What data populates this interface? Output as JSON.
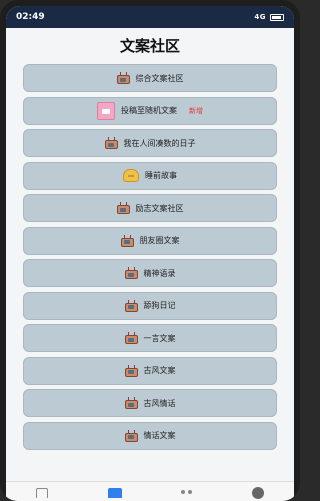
{
  "statusbar": {
    "time": "02:49",
    "signal": "4G",
    "battery_icon": "battery-icon"
  },
  "page": {
    "title": "文案社区"
  },
  "items": [
    {
      "label": "综合文案社区",
      "icon": "tv-icon"
    },
    {
      "label": "投稿至随机文案",
      "icon": "pink-card-icon",
      "badge": "新增"
    },
    {
      "label": "我在人间凑数的日子",
      "icon": "tv-icon"
    },
    {
      "label": "睡前故事",
      "icon": "bread-icon"
    },
    {
      "label": "励志文案社区",
      "icon": "tv-icon"
    },
    {
      "label": "朋友圈文案",
      "icon": "tv-icon"
    },
    {
      "label": "精神语录",
      "icon": "tv-icon"
    },
    {
      "label": "舔狗日记",
      "icon": "tv-icon"
    },
    {
      "label": "一言文案",
      "icon": "tv-icon"
    },
    {
      "label": "古风文案",
      "icon": "tv-icon"
    },
    {
      "label": "古风情话",
      "icon": "tv-icon"
    },
    {
      "label": "情话文案",
      "icon": "tv-icon"
    }
  ],
  "bottom_nav": [
    {
      "name": "nav-home",
      "icon": "doc-icon",
      "active": false
    },
    {
      "name": "nav-community",
      "icon": "clipboard-icon",
      "active": true
    },
    {
      "name": "nav-discover",
      "icon": "dots-icon",
      "active": false
    },
    {
      "name": "nav-mine",
      "icon": "plus-icon",
      "active": false
    }
  ],
  "colors": {
    "accent": "#2f80ed",
    "item_bg": "#bccad3",
    "status_bg": "#1b2a44"
  }
}
